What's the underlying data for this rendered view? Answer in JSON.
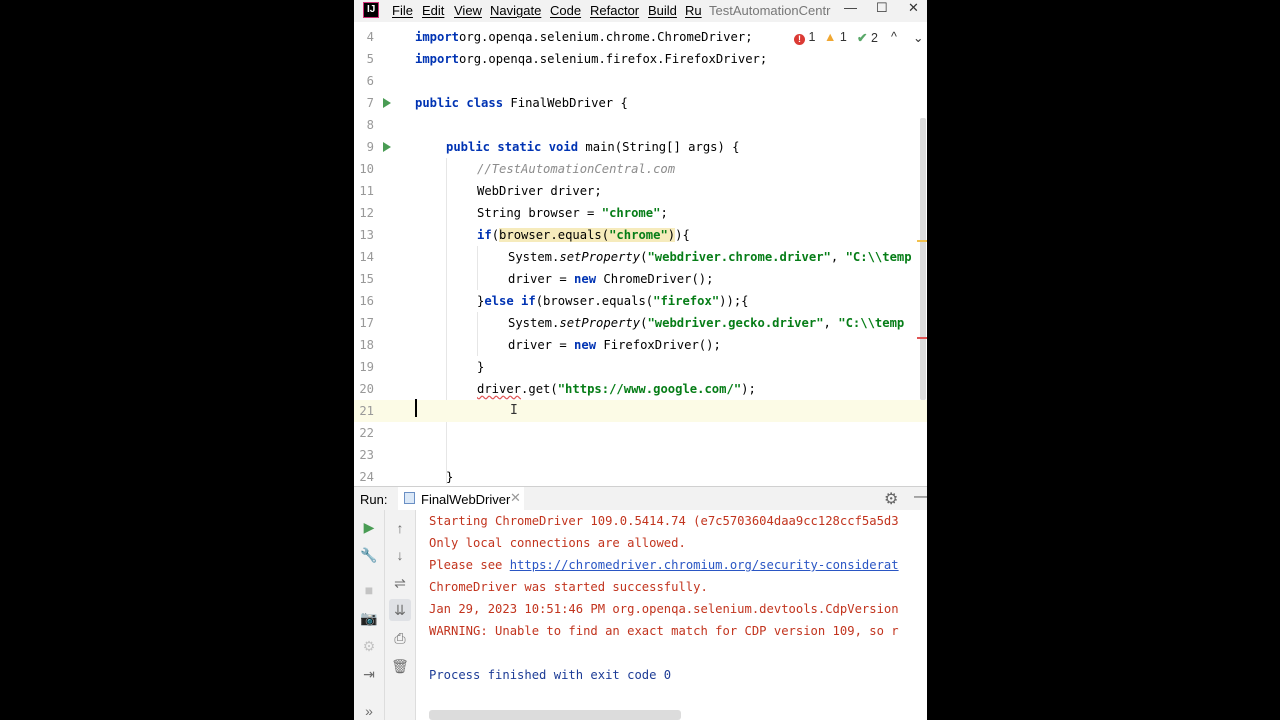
{
  "window": {
    "title": "TestAutomationCentr",
    "logo_text": "IJ",
    "controls": {
      "minimize": "—",
      "maximize": "☐",
      "close": "✕"
    }
  },
  "menu": [
    "File",
    "Edit",
    "View",
    "Navigate",
    "Code",
    "Refactor",
    "Build",
    "Ru"
  ],
  "inspection": {
    "errors": "1",
    "warnings": "1",
    "ok": "2",
    "up": "^",
    "down": "⌄"
  },
  "editor": {
    "lines": [
      {
        "num": "4",
        "parts": [
          [
            "kw",
            "import"
          ],
          [
            "",
            "org.openqa.selenium.chrome.ChromeDriver;"
          ]
        ]
      },
      {
        "num": "5",
        "parts": [
          [
            "kw",
            "import"
          ],
          [
            "",
            "org.openqa.selenium.firefox.FirefoxDriver;"
          ]
        ]
      },
      {
        "num": "6",
        "parts": []
      },
      {
        "num": "7",
        "parts": [
          [
            "kw",
            "public class"
          ],
          [
            "",
            " FinalWebDriver {"
          ]
        ]
      },
      {
        "num": "8",
        "parts": []
      },
      {
        "num": "9",
        "parts": [
          [
            "kw",
            "public static void"
          ],
          [
            "",
            " main(String[] args) {"
          ]
        ]
      },
      {
        "num": "10",
        "parts": [
          [
            "cmt",
            "//TestAutomationCentral.com"
          ]
        ]
      },
      {
        "num": "11",
        "parts": [
          [
            "",
            "WebDriver driver;"
          ]
        ]
      },
      {
        "num": "12",
        "parts": [
          [
            "",
            "String browser = "
          ],
          [
            "str",
            "\"chrome\""
          ],
          [
            "",
            ";"
          ]
        ]
      },
      {
        "num": "13",
        "parts": [
          [
            "kw",
            "if"
          ],
          [
            "",
            "("
          ],
          [
            "hl",
            "browser.equals("
          ],
          [
            "hlstr",
            "\"chrome\""
          ],
          [
            "hl",
            ")"
          ],
          [
            "",
            ")"
          ],
          [
            "",
            "{"
          ]
        ]
      },
      {
        "num": "14",
        "parts": [
          [
            "",
            "System."
          ],
          [
            "it",
            "setProperty"
          ],
          [
            "",
            "("
          ],
          [
            "str",
            "\"webdriver.chrome.driver\""
          ],
          [
            "",
            ", "
          ],
          [
            "str",
            "\"C:\\\\temp"
          ]
        ]
      },
      {
        "num": "15",
        "parts": [
          [
            "",
            "driver = "
          ],
          [
            "kw",
            "new"
          ],
          [
            "",
            " ChromeDriver();"
          ]
        ]
      },
      {
        "num": "16",
        "parts": [
          [
            "",
            "}"
          ],
          [
            "kw",
            "else if"
          ],
          [
            "",
            "(browser.equals("
          ],
          [
            "str",
            "\"firefox\""
          ],
          [
            "",
            "));{"
          ]
        ]
      },
      {
        "num": "17",
        "parts": [
          [
            "",
            "System."
          ],
          [
            "it",
            "setProperty"
          ],
          [
            "",
            "("
          ],
          [
            "str",
            "\"webdriver.gecko.driver\""
          ],
          [
            "",
            ", "
          ],
          [
            "str",
            "\"C:\\\\temp"
          ]
        ]
      },
      {
        "num": "18",
        "parts": [
          [
            "",
            "driver = "
          ],
          [
            "kw",
            "new"
          ],
          [
            "",
            " FirefoxDriver();"
          ]
        ]
      },
      {
        "num": "19",
        "parts": [
          [
            "",
            "}"
          ]
        ]
      },
      {
        "num": "20",
        "parts": [
          [
            "err",
            "driver"
          ],
          [
            "",
            ".get("
          ],
          [
            "str",
            "\"https://www.google.com/\""
          ],
          [
            "",
            ");"
          ]
        ]
      },
      {
        "num": "21",
        "parts": []
      },
      {
        "num": "22",
        "parts": []
      },
      {
        "num": "23",
        "parts": []
      },
      {
        "num": "24",
        "parts": [
          [
            "",
            "}"
          ]
        ]
      }
    ],
    "ibeam": "I"
  },
  "run": {
    "label": "Run:",
    "tab": "FinalWebDriver",
    "tab_close": "✕",
    "settings": "⚙",
    "hide": "—",
    "toolbar1": [
      "▶",
      "🔧",
      "■",
      "📷",
      "⚙",
      "⇥",
      "»"
    ],
    "toolbar2": [
      "↑",
      "↓",
      "⇌",
      "⇊",
      "⎙",
      "🗑"
    ],
    "console": [
      {
        "text": "Starting ChromeDriver 109.0.5414.74 (e7c5703604daa9cc128ccf5a5d3"
      },
      {
        "text": "Only local connections are allowed."
      },
      {
        "prefix": "Please see ",
        "link": "https://chromedriver.chromium.org/security-considerat"
      },
      {
        "text": "ChromeDriver was started successfully."
      },
      {
        "text": "Jan 29, 2023 10:51:46 PM org.openqa.selenium.devtools.CdpVersion"
      },
      {
        "text": "WARNING: Unable to find an exact match for CDP version 109, so r"
      },
      {
        "text": ""
      },
      {
        "text": "Process finished with exit code 0",
        "ok": true
      }
    ]
  }
}
